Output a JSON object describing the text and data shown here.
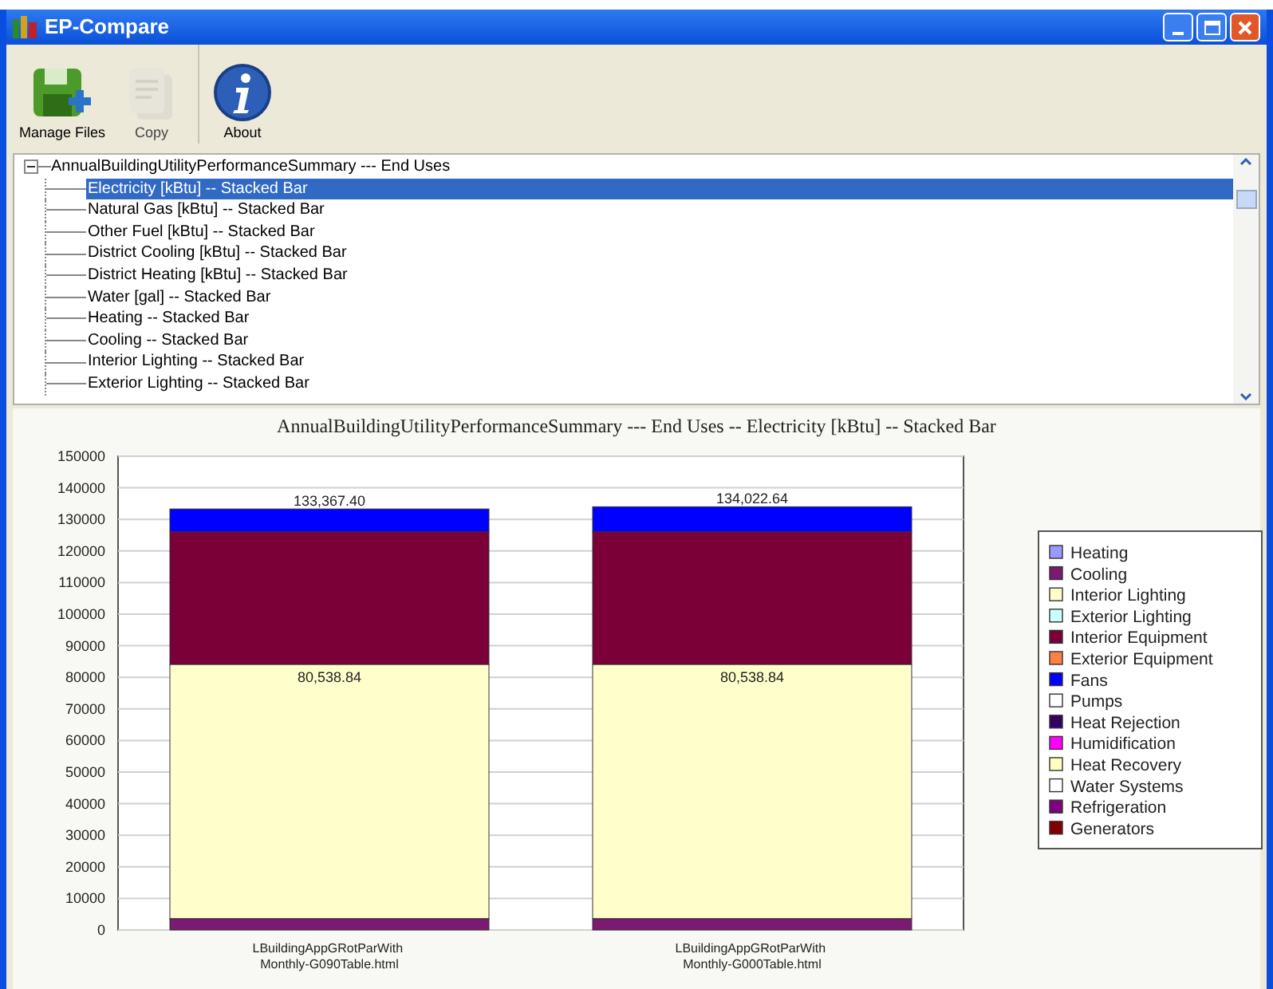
{
  "window": {
    "title": "EP-Compare"
  },
  "toolbar": [
    {
      "label": "Manage Files",
      "kind": "save",
      "disabled": false
    },
    {
      "label": "Copy",
      "kind": "copy",
      "disabled": true
    },
    {
      "label": "About",
      "kind": "info",
      "disabled": false
    }
  ],
  "tree": {
    "label": "AnnualBuildingUtilityPerformanceSummary --- End Uses",
    "expanded": true,
    "children": [
      {
        "label": "Electricity [kBtu] -- Stacked Bar",
        "selected": true
      },
      {
        "label": "Natural Gas [kBtu] -- Stacked Bar",
        "selected": false
      },
      {
        "label": "Other Fuel [kBtu] -- Stacked Bar",
        "selected": false
      },
      {
        "label": "District Cooling [kBtu] -- Stacked Bar",
        "selected": false
      },
      {
        "label": "District Heating [kBtu] -- Stacked Bar",
        "selected": false
      },
      {
        "label": "Water [gal] -- Stacked Bar",
        "selected": false
      },
      {
        "label": "Heating -- Stacked Bar",
        "selected": false
      },
      {
        "label": "Cooling -- Stacked Bar",
        "selected": false
      },
      {
        "label": "Interior Lighting -- Stacked Bar",
        "selected": false
      },
      {
        "label": "Exterior Lighting -- Stacked Bar",
        "selected": false
      }
    ]
  },
  "chart": {
    "chart_data": {
      "type": "bar",
      "stacked": true,
      "title": "AnnualBuildingUtilityPerformanceSummary --- End Uses -- Electricity [kBtu] -- Stacked Bar",
      "categories": [
        "LBuildingAppGRotParWith Monthly-G090Table.html",
        "LBuildingAppGRotParWith Monthly-G000Table.html"
      ],
      "ylim": [
        0,
        150000
      ],
      "yticks": [
        0,
        10000,
        20000,
        30000,
        40000,
        50000,
        60000,
        70000,
        80000,
        90000,
        100000,
        110000,
        120000,
        130000,
        140000,
        150000
      ],
      "series": [
        {
          "name": "Heating",
          "color": "#9999ff",
          "values": [
            null,
            null
          ]
        },
        {
          "name": "Cooling",
          "color": "#7a1a73",
          "values": [
            3600,
            3600
          ]
        },
        {
          "name": "Interior Lighting",
          "color": "#ffffcc",
          "values": [
            80500,
            80500
          ]
        },
        {
          "name": "Exterior Lighting",
          "color": "#ccffff",
          "values": [
            null,
            null
          ]
        },
        {
          "name": "Interior Equipment",
          "color": "#7b0038",
          "values": [
            42000,
            42000
          ]
        },
        {
          "name": "Exterior Equipment",
          "color": "#ff8040",
          "values": [
            null,
            null
          ]
        },
        {
          "name": "Fans",
          "color": "#0000ff",
          "values": [
            7200,
            7900
          ]
        },
        {
          "name": "Pumps",
          "color": "#ffffff",
          "values": [
            null,
            null
          ]
        },
        {
          "name": "Heat Rejection",
          "color": "#330066",
          "values": [
            null,
            null
          ]
        },
        {
          "name": "Humidification",
          "color": "#ff00ff",
          "values": [
            null,
            null
          ]
        },
        {
          "name": "Heat Recovery",
          "color": "#ffffc0",
          "values": [
            null,
            null
          ]
        },
        {
          "name": "Water Systems",
          "color": "#ffffff",
          "values": [
            null,
            null
          ]
        },
        {
          "name": "Refrigeration",
          "color": "#800080",
          "values": [
            null,
            null
          ]
        },
        {
          "name": "Generators",
          "color": "#800000",
          "values": [
            null,
            null
          ]
        }
      ],
      "grid": true,
      "legend": true,
      "annotations": [
        {
          "x": "LBuildingAppGRotParWith Monthly-G090Table.html",
          "y": 133367,
          "text": "133,367.40"
        },
        {
          "x": "LBuildingAppGRotParWith Monthly-G090Table.html",
          "y": 84100,
          "text": "80,538.84"
        },
        {
          "x": "LBuildingAppGRotParWith Monthly-G000Table.html",
          "y": 134023,
          "text": "134,022.64"
        },
        {
          "x": "LBuildingAppGRotParWith Monthly-G000Table.html",
          "y": 84100,
          "text": "80,538.84"
        }
      ]
    }
  }
}
